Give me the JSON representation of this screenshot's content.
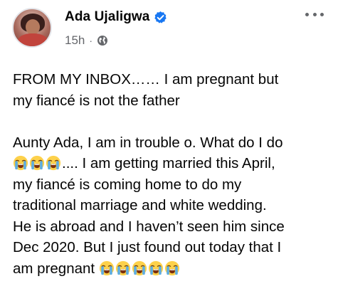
{
  "post": {
    "author": "Ada Ujaligwa",
    "time": "15h",
    "separator": "·",
    "line1": "FROM MY INBOX…… I am pregnant but",
    "line2": "my fiancé is not the father",
    "line3": "Aunty Ada, I am in trouble o. What do I do",
    "line4_after_emojis": ".... I am getting married this April,",
    "line5": "my fiancé is coming home to do my",
    "line6": "traditional marriage and white wedding.",
    "line7": "He is abroad and I haven’t seen him since",
    "line8": "Dec 2020. But I just found out today that I",
    "line9": "am pregnant "
  },
  "icons": {
    "verified": "verified-badge-icon",
    "audience": "globe-icon",
    "more": "more-options-icon",
    "emoji": "loudly-crying-face-emoji"
  },
  "colors": {
    "text": "#050505",
    "secondary": "#65676b",
    "verified_blue": "#1877f2",
    "emoji_yellow": "#fdd14b"
  }
}
